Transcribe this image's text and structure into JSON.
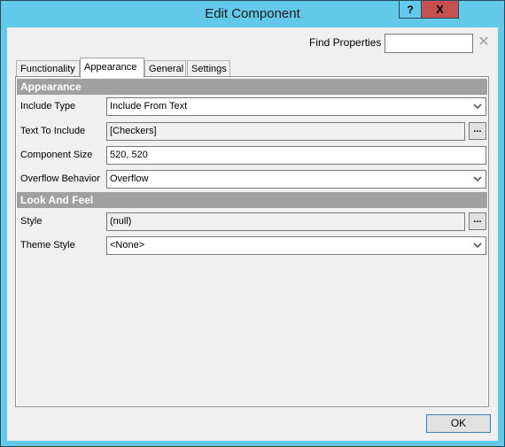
{
  "window": {
    "title": "Edit Component",
    "help_label": "?",
    "close_label": "X"
  },
  "find": {
    "label": "Find Properties",
    "value": "",
    "placeholder": "",
    "clear_label": "✕"
  },
  "tabs": [
    {
      "label": "Functionality",
      "active": false
    },
    {
      "label": "Appearance",
      "active": true
    },
    {
      "label": "General",
      "active": false
    },
    {
      "label": "Settings",
      "active": false
    }
  ],
  "sections": {
    "appearance": {
      "title": "Appearance",
      "properties": {
        "include_type": {
          "label": "Include Type",
          "value": "Include From Text",
          "type": "dropdown"
        },
        "text_to_include": {
          "label": "Text To Include",
          "value": "[Checkers]",
          "type": "readonly-with-button",
          "button_label": "..."
        },
        "component_size": {
          "label": "Component Size",
          "value": "520, 520",
          "type": "text"
        },
        "overflow_behavior": {
          "label": "Overflow Behavior",
          "value": "Overflow",
          "type": "dropdown"
        }
      }
    },
    "look_and_feel": {
      "title": "Look And Feel",
      "properties": {
        "style": {
          "label": "Style",
          "value": "(null)",
          "type": "readonly-with-button",
          "button_label": "..."
        },
        "theme_style": {
          "label": "Theme Style",
          "value": "<None>",
          "type": "dropdown"
        }
      }
    }
  },
  "footer": {
    "ok_label": "OK"
  },
  "colors": {
    "titlebar": "#63c9ea",
    "close_button": "#c75050",
    "section_header": "#a0a0a0",
    "dialog_bg": "#f0f0f0"
  }
}
